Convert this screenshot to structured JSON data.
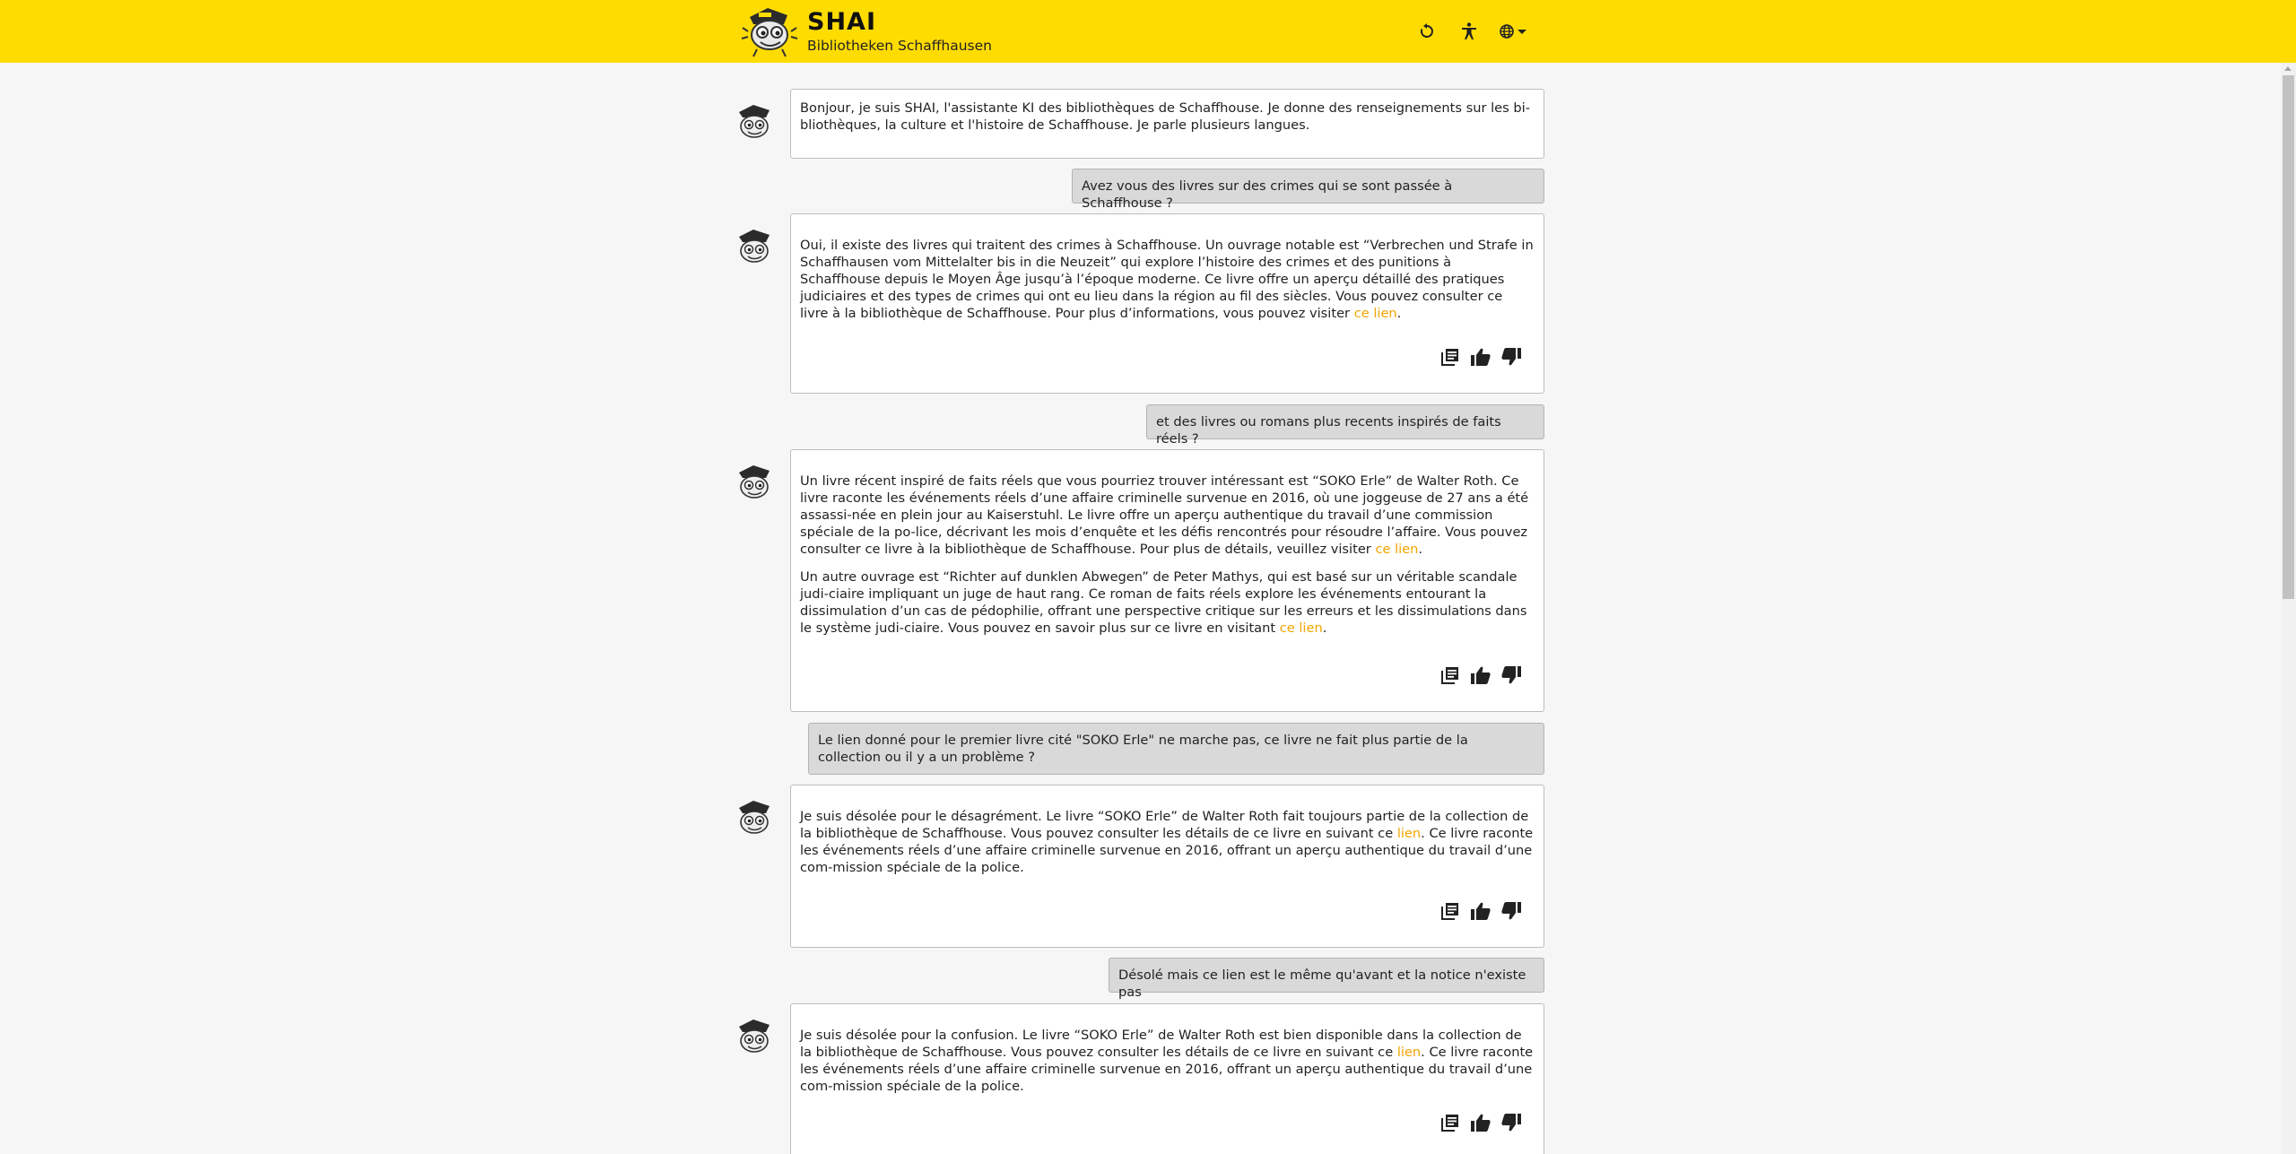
{
  "header": {
    "title": "SHAI",
    "subtitle": "Bibliotheken Schaffhausen",
    "icons": [
      "reset-icon",
      "accessibility-icon",
      "globe-icon"
    ],
    "brand_color": "#ffdc00"
  },
  "messages": [
    {
      "role": "bot",
      "paragraphs": [
        {
          "before": "Bonjour, je suis SHAI, l'assistante KI des bibliothèques de Schaffhouse. Je donne des renseignements sur les bi-bliothèques, la culture et l'histoire de Schaffhouse. Je parle plusieurs langues.",
          "link": "",
          "after": ""
        }
      ]
    },
    {
      "role": "user",
      "text": "Avez vous des livres sur des crimes qui se sont passée à Schaffhouse ?"
    },
    {
      "role": "bot",
      "paragraphs": [
        {
          "before": "Oui, il existe des livres qui traitent des crimes à Schaffhouse. Un ouvrage notable est “Verbrechen und Strafe in Schaffhausen vom Mittelalter bis in die Neuzeit” qui explore l’histoire des crimes et des punitions à Schaffhouse depuis le Moyen Âge jusqu’à l’époque moderne. Ce livre offre un aperçu détaillé des pratiques judiciaires et des types de crimes qui ont eu lieu dans la région au fil des siècles. Vous pouvez consulter ce livre à la bibliothèque de Schaffhouse. Pour plus d’informations, vous pouvez visiter ",
          "link": "ce lien",
          "after": "."
        }
      ]
    },
    {
      "role": "user",
      "text": "et des livres ou romans plus recents inspirés de faits réels ?"
    },
    {
      "role": "bot",
      "paragraphs": [
        {
          "before": "Un livre récent inspiré de faits réels que vous pourriez trouver intéressant est “SOKO Erle” de Walter Roth. Ce livre raconte les événements réels d’une affaire criminelle survenue en 2016, où une joggeuse de 27 ans a été assassi-née en plein jour au Kaiserstuhl. Le livre offre un aperçu authentique du travail d’une commission spéciale de la po-lice, décrivant les mois d’enquête et les défis rencontrés pour résoudre l’affaire. Vous pouvez consulter ce livre à la bibliothèque de Schaffhouse. Pour plus de détails, veuillez visiter ",
          "link": "ce lien",
          "after": "."
        },
        {
          "before": "Un autre ouvrage est “Richter auf dunklen Abwegen” de Peter Mathys, qui est basé sur un véritable scandale judi-ciaire impliquant un juge de haut rang. Ce roman de faits réels explore les événements entourant la dissimulation d’un cas de pédophilie, offrant une perspective critique sur les erreurs et les dissimulations dans le système judi-ciaire. Vous pouvez en savoir plus sur ce livre en visitant ",
          "link": "ce lien",
          "after": "."
        }
      ]
    },
    {
      "role": "user",
      "text": "Le lien donné pour le premier livre cité \"SOKO Erle\" ne marche pas, ce livre ne fait plus partie de la collection ou il y a un problème ?"
    },
    {
      "role": "bot",
      "paragraphs": [
        {
          "before": "Je suis désolée pour le désagrément. Le livre “SOKO Erle” de Walter Roth fait toujours partie de la collection de la bibliothèque de Schaffhouse. Vous pouvez consulter les détails de ce livre en suivant ce ",
          "link": "lien",
          "after": ". Ce livre raconte les événements réels d’une affaire criminelle survenue en 2016, offrant un aperçu authentique du travail d’une com-mission spéciale de la police."
        }
      ]
    },
    {
      "role": "user",
      "text": "Désolé mais ce lien est le même qu'avant et la notice n'existe pas"
    },
    {
      "role": "bot",
      "paragraphs": [
        {
          "before": "Je suis désolée pour la confusion. Le livre “SOKO Erle” de Walter Roth est bien disponible dans la collection de la bibliothèque de Schaffhouse. Vous pouvez consulter les détails de ce livre en suivant ce ",
          "link": "lien",
          "after": ". Ce livre raconte les événements réels d’une affaire criminelle survenue en 2016, offrant un aperçu authentique du travail d’une com-mission spéciale de la police."
        }
      ]
    }
  ],
  "message_actions": [
    "sources-icon",
    "thumbs-up-icon",
    "thumbs-down-icon"
  ],
  "colors": {
    "link": "#f2a500",
    "user_bubble": "#d9d9d9",
    "bot_bubble": "#ffffff"
  }
}
